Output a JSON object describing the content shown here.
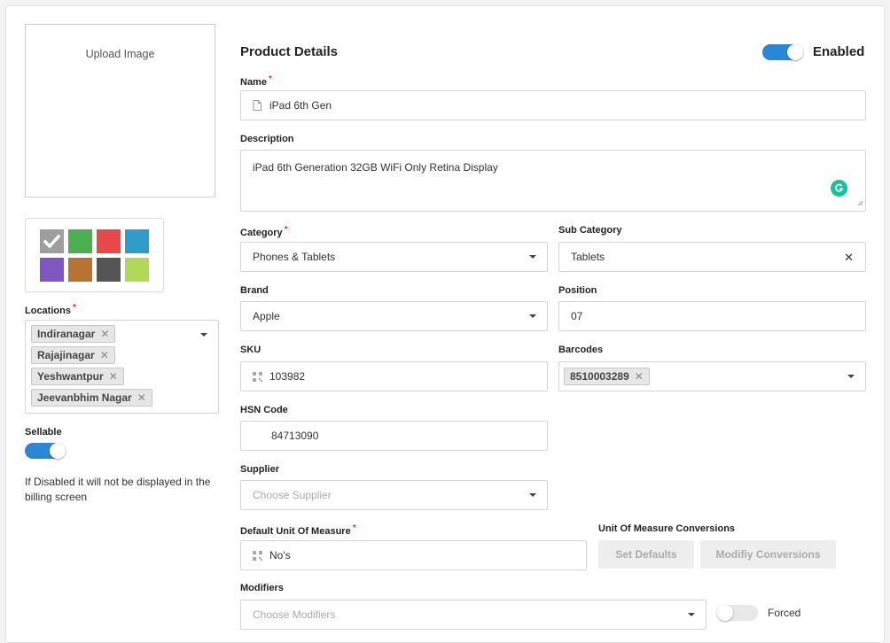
{
  "upload": {
    "label": "Upload Image"
  },
  "swatches": [
    {
      "color": "#9e9e9e",
      "selected": true
    },
    {
      "color": "#4caf50",
      "selected": false
    },
    {
      "color": "#e84848",
      "selected": false
    },
    {
      "color": "#2f9ccc",
      "selected": false
    },
    {
      "color": "#7e57c2",
      "selected": false
    },
    {
      "color": "#b87333",
      "selected": false
    },
    {
      "color": "#555555",
      "selected": false
    },
    {
      "color": "#b0d95a",
      "selected": false
    }
  ],
  "locations": {
    "label": "Locations",
    "tags": [
      "Indiranagar",
      "Rajajinagar",
      "Yeshwantpur",
      "Jeevanbhim Nagar"
    ]
  },
  "sellable": {
    "label": "Sellable",
    "enabled": true,
    "help": "If Disabled it will not be displayed in the billing screen"
  },
  "header": {
    "title": "Product Details",
    "enabled_label": "Enabled",
    "enabled": true
  },
  "name": {
    "label": "Name",
    "value": "iPad 6th Gen"
  },
  "description": {
    "label": "Description",
    "value": "iPad 6th Generation 32GB WiFi Only Retina Display"
  },
  "category": {
    "label": "Category",
    "value": "Phones & Tablets"
  },
  "sub_category": {
    "label": "Sub Category",
    "value": "Tablets"
  },
  "brand": {
    "label": "Brand",
    "value": "Apple"
  },
  "position": {
    "label": "Position",
    "value": "07"
  },
  "sku": {
    "label": "SKU",
    "value": "103982"
  },
  "barcodes": {
    "label": "Barcodes",
    "tags": [
      "8510003289"
    ]
  },
  "hsn": {
    "label": "HSN Code",
    "value": "84713090"
  },
  "supplier": {
    "label": "Supplier",
    "placeholder": "Choose Supplier"
  },
  "uom": {
    "label": "Default Unit Of Measure",
    "value": "No's"
  },
  "uom_conversions": {
    "label": "Unit Of Measure Conversions",
    "set_defaults": "Set Defaults",
    "modify": "Modifiy Conversions"
  },
  "modifiers": {
    "label": "Modifiers",
    "placeholder": "Choose Modifiers",
    "forced_label": "Forced",
    "forced": false
  },
  "colors": {
    "accent": "#2a87d6",
    "required": "#e53935",
    "grammarly": "#15c39a"
  }
}
